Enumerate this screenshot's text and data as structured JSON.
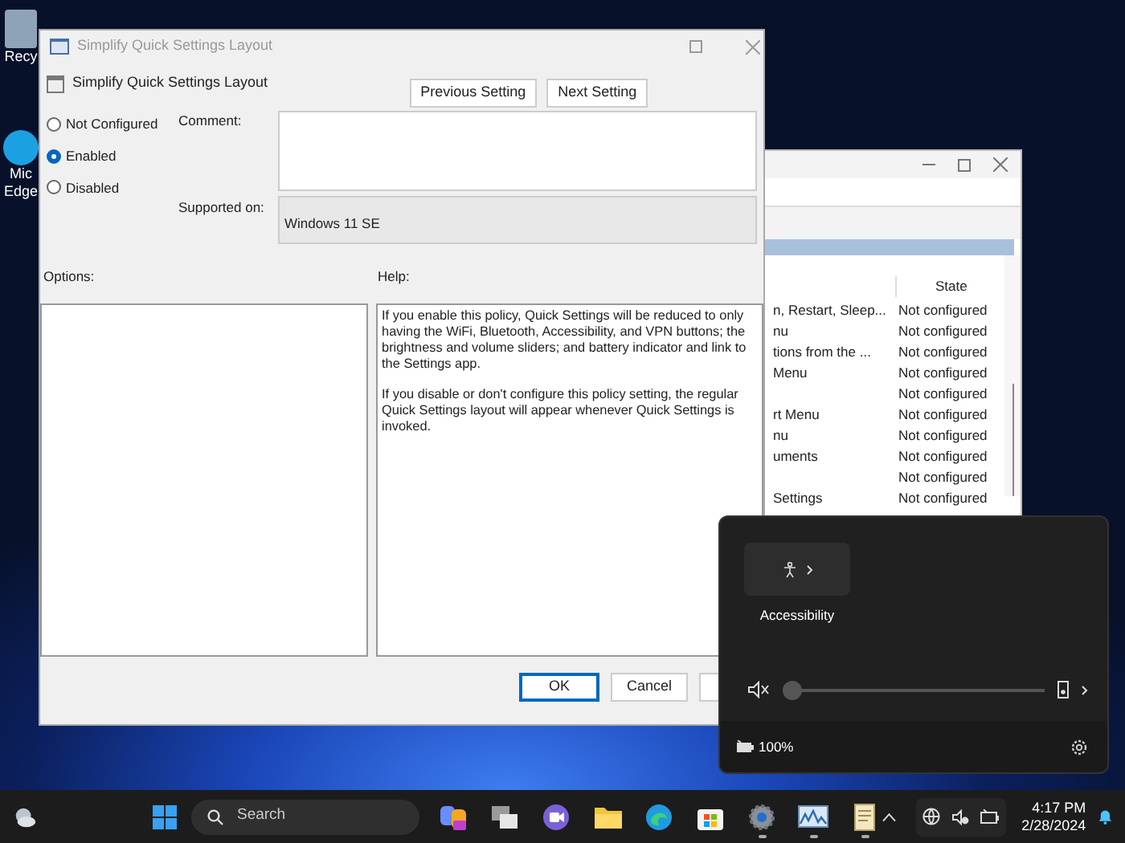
{
  "desktop": {
    "icons": [
      {
        "lines": [
          "Recy"
        ]
      },
      {
        "lines": [
          "Mic",
          "Edge"
        ]
      }
    ]
  },
  "back_window": {
    "columns": [
      {
        "label": "State"
      }
    ],
    "rows": [
      {
        "name": "n, Restart, Sleep...",
        "state": "Not configured"
      },
      {
        "name": "nu",
        "state": "Not configured"
      },
      {
        "name": "tions from the ...",
        "state": "Not configured"
      },
      {
        "name": "Menu",
        "state": "Not configured"
      },
      {
        "name": "",
        "state": "Not configured"
      },
      {
        "name": "rt Menu",
        "state": "Not configured"
      },
      {
        "name": "nu",
        "state": "Not configured"
      },
      {
        "name": "uments",
        "state": "Not configured"
      },
      {
        "name": "",
        "state": "Not configured"
      },
      {
        "name": "Settings",
        "state": "Not configured"
      }
    ]
  },
  "dialog": {
    "title": "Simplify Quick Settings Layout",
    "header": "Simplify Quick Settings Layout",
    "nav_buttons": [
      "Previous Setting",
      "Next Setting"
    ],
    "radios": [
      {
        "label": "Not Configured",
        "selected": false
      },
      {
        "label": "Enabled",
        "selected": true
      },
      {
        "label": "Disabled",
        "selected": false
      }
    ],
    "comment_label": "Comment:",
    "supported_label": "Supported on:",
    "supported_value": "Windows 11 SE",
    "options_label": "Options:",
    "help_label": "Help:",
    "help_text": [
      "If you enable this policy, Quick Settings will be reduced to only having the WiFi, Bluetooth, Accessibility, and VPN buttons; the brightness and volume sliders; and battery indicator and link to the Settings app.",
      "If you disable or don't configure this policy setting, the regular Quick Settings layout will appear whenever Quick Settings is invoked."
    ],
    "buttons": [
      {
        "label": "OK",
        "default": true
      },
      {
        "label": "Cancel",
        "default": false
      }
    ]
  },
  "quick_settings": {
    "tiles": [
      {
        "label": "Accessibility"
      }
    ],
    "volume": {
      "level": 0,
      "muted": true
    },
    "battery": "100%"
  },
  "taskbar": {
    "search_placeholder": "Search",
    "apps": [
      {
        "kind": "copilot",
        "running": false
      },
      {
        "kind": "taskview",
        "running": false
      },
      {
        "kind": "chat",
        "running": false
      },
      {
        "kind": "folder",
        "running": false
      },
      {
        "kind": "browser",
        "running": false
      },
      {
        "kind": "store",
        "running": false
      },
      {
        "kind": "settings",
        "running": true
      },
      {
        "kind": "monitor",
        "running": true
      },
      {
        "kind": "notepad",
        "running": true
      }
    ],
    "time": "4:17 PM",
    "date": "2/28/2024"
  }
}
